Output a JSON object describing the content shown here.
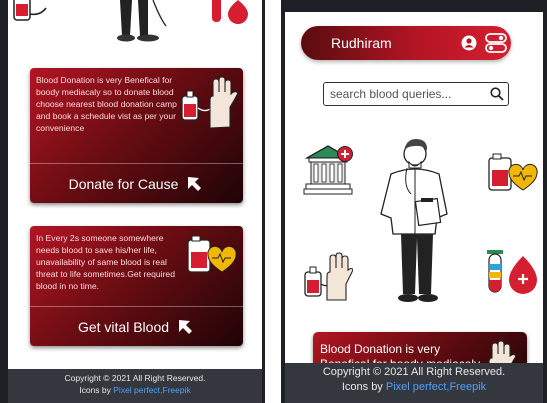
{
  "left_screen": {
    "card1": {
      "text": "Blood Donation is very Benefical for boody mediacaly so to donate blood choose nearest blood donation camp and book a schedule vist as per your convenience",
      "button_label": "Donate for Cause"
    },
    "card2": {
      "text": "In Every 2s someone somewhere needs blood to save his/her life, unavailability of same blood is real threat to life sometimes.Get required blood in no time.",
      "button_label": "Get vital Blood"
    },
    "footer": {
      "copyright": "Copyright © 2021 All Right Reserved.",
      "credits_prefix": "Icons by",
      "credits_link": "Pixel perfect,Freepik"
    }
  },
  "right_screen": {
    "navbar": {
      "brand": "Rudhiram"
    },
    "search": {
      "placeholder": "search blood queries..."
    },
    "card_preview": {
      "text_line1": "Blood Donation is very",
      "text_line2": "Benefical for boody mediacaly"
    },
    "footer": {
      "copyright": "Copyright © 2021 All Right Reserved.",
      "credits_prefix": "Icons by",
      "credits_link": "Pixel perfect,Freepik"
    }
  },
  "colors": {
    "accent": "#b31524",
    "dark": "#1f0407",
    "footer_bg": "#34373d",
    "link": "#4ea1ff"
  },
  "icons": [
    "blood-bag-icon",
    "hand-blood-donation-icon",
    "cursor-arrow-icon",
    "user-icon",
    "toggle-icon",
    "search-icon",
    "hospital-icon",
    "blood-bag-heart-icon",
    "doctor-illustration",
    "test-tubes-drop-icon"
  ]
}
